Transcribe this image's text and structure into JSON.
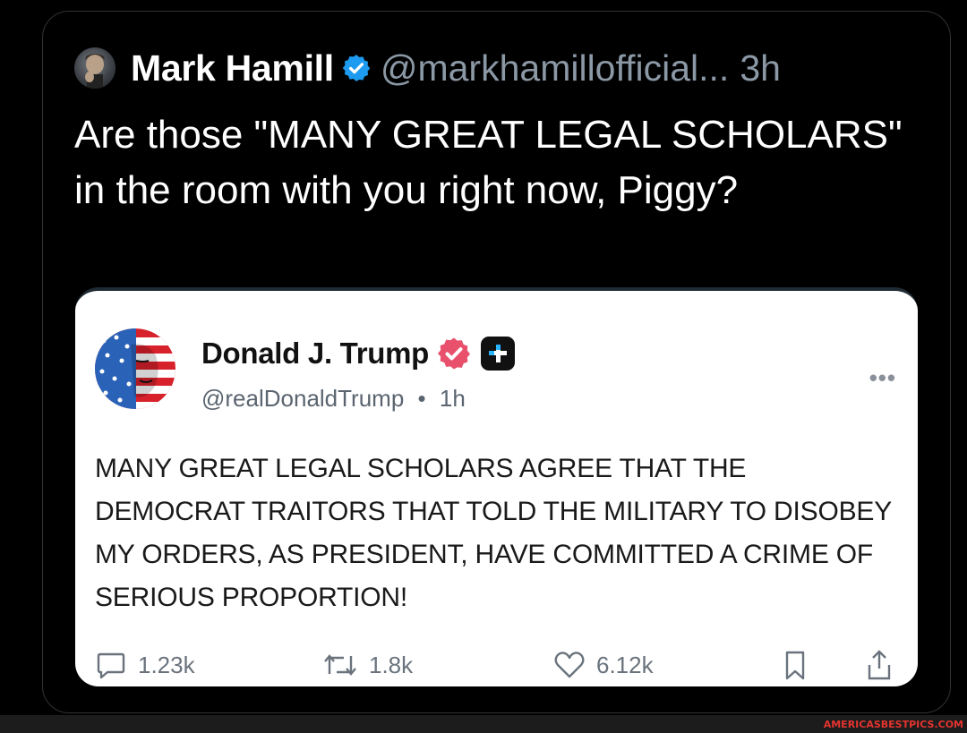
{
  "post": {
    "author_name": "Mark Hamill",
    "handle": "@markhamillofficial...",
    "timestamp": "3h",
    "text": "Are those \"MANY GREAT LEGAL SCHOLARS\" in the room with you right now, Piggy?"
  },
  "quoted_post": {
    "author_name": "Donald J. Trump",
    "handle": "@realDonaldTrump",
    "separator": "•",
    "timestamp": "1h",
    "text": "MANY GREAT LEGAL SCHOLARS AGREE THAT THE DEMOCRAT TRAITORS THAT TOLD THE MILITARY TO DISOBEY MY ORDERS, AS PRESIDENT, HAVE COMMITTED A CRIME OF SERIOUS PROPORTION!",
    "more_icon": "•••",
    "actions": {
      "replies": "1.23k",
      "reposts": "1.8k",
      "likes": "6.12k"
    }
  },
  "watermark": "AMERICASBESTPICS.COM",
  "colors": {
    "background": "#000000",
    "verified_blue": "#1d9bf0",
    "verified_pink": "#e8506b",
    "secondary_text": "#8b98a5",
    "watermark_red": "#e3342f"
  },
  "icons": {
    "avatar": "profile-photo",
    "verified": "verified-check-icon",
    "reply": "speech-bubble-icon",
    "repost": "repost-arrows-icon",
    "like": "heart-icon",
    "bookmark": "bookmark-icon",
    "share": "share-icon"
  }
}
